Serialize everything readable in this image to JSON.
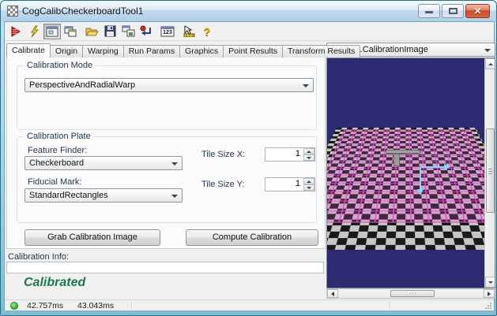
{
  "window": {
    "title": "CogCalibCheckerboardTool1"
  },
  "toolbar": {
    "icons": [
      "run",
      "electric-run",
      "show-image-window",
      "float-windows",
      "open-file",
      "save-file",
      "copy-results",
      "reset",
      "numeric-results",
      "position-tool",
      "help"
    ],
    "calc_label": "123",
    "help_label": "?"
  },
  "tabs": {
    "active": "Calibrate",
    "items": [
      {
        "label": "Calibrate"
      },
      {
        "label": "Origin"
      },
      {
        "label": "Warping"
      },
      {
        "label": "Run Params"
      },
      {
        "label": "Graphics"
      },
      {
        "label": "Point Results"
      },
      {
        "label": "Transform Results"
      }
    ]
  },
  "calibration_mode": {
    "caption": "Calibration Mode",
    "value": "PerspectiveAndRadialWarp"
  },
  "calibration_plate": {
    "caption": "Calibration Plate",
    "feature_finder_label": "Feature Finder:",
    "feature_finder_value": "Checkerboard",
    "fiducial_mark_label": "Fiducial Mark:",
    "fiducial_mark_value": "StandardRectangles",
    "tile_size_x_label": "Tile Size X:",
    "tile_size_x_value": "1",
    "tile_size_y_label": "Tile Size Y:",
    "tile_size_y_value": "1"
  },
  "buttons": {
    "grab": "Grab Calibration Image",
    "compute": "Compute Calibration"
  },
  "calibration_info": {
    "label": "Calibration Info:",
    "value": ""
  },
  "result_text": "Calibrated",
  "status_bar": {
    "time1": "42.757ms",
    "time2": "43.043ms"
  },
  "image_panel": {
    "selector_value": "Current.CalibrationImage",
    "axis_x_label": "x",
    "background_color": "#2b2a72",
    "overlay_color": "#ec48d4",
    "axis_color": "#7fd8f4"
  },
  "colors": {
    "result_green": "#19794a",
    "led_green": "#3dbb3d",
    "close_red": "#cc4526",
    "frame_blue": "#9fd2e2"
  }
}
